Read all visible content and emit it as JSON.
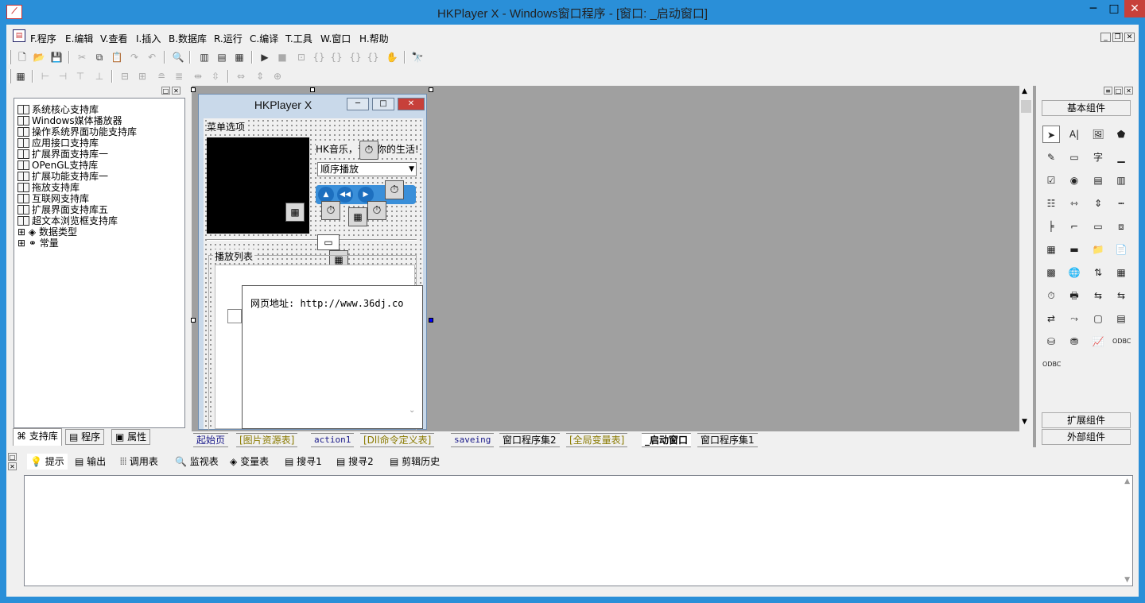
{
  "window": {
    "title": "HKPlayer X - Windows窗口程序 - [窗口: _启动窗口]",
    "min": "─",
    "max": "□",
    "close": "✕"
  },
  "menu": {
    "items": [
      "F.程序",
      "E.编辑",
      "V.查看",
      "I.插入",
      "B.数据库",
      "R.运行",
      "C.编译",
      "T.工具",
      "W.窗口",
      "H.帮助"
    ]
  },
  "left_panel": {
    "tree": [
      {
        "label": "系统核心支持库",
        "kind": "book"
      },
      {
        "label": "Windows媒体播放器",
        "kind": "book"
      },
      {
        "label": "操作系统界面功能支持库",
        "kind": "book"
      },
      {
        "label": "应用接口支持库",
        "kind": "book"
      },
      {
        "label": "扩展界面支持库一",
        "kind": "book"
      },
      {
        "label": "OPenGL支持库",
        "kind": "book"
      },
      {
        "label": "扩展功能支持库一",
        "kind": "book"
      },
      {
        "label": "拖放支持库",
        "kind": "book"
      },
      {
        "label": "互联网支持库",
        "kind": "book"
      },
      {
        "label": "扩展界面支持库五",
        "kind": "book"
      },
      {
        "label": "超文本浏览框支持库",
        "kind": "book"
      },
      {
        "label": "数据类型",
        "kind": "expand"
      },
      {
        "label": "常量",
        "kind": "expand"
      }
    ],
    "tabs": [
      "支持库",
      "程序",
      "属性"
    ]
  },
  "form": {
    "title": "HKPlayer X",
    "menu_label": "菜单选项",
    "slogan": "HK音乐，音乐你的生活!",
    "play_mode": "顺序播放",
    "playlist_label": "播放列表",
    "url_text": "网页地址: http://www.36dj.co"
  },
  "right_panel": {
    "basic": "基本组件",
    "extended": "扩展组件",
    "external": "外部组件"
  },
  "bottom_tabs": [
    "起始页",
    "[图片资源表]",
    "action1",
    "[Dll命令定义表]",
    "saveing",
    "窗口程序集2",
    "[全局变量表]",
    "_启动窗口",
    "窗口程序集1"
  ],
  "output_tabs": [
    "提示",
    "输出",
    "调用表",
    "监视表",
    "变量表",
    "搜寻1",
    "搜寻2",
    "剪辑历史"
  ],
  "colors": {
    "accent": "#2a8fd8",
    "designer_bg": "#a0a0a0",
    "form_frame": "#c9d9ea",
    "close_red": "#c7403a"
  }
}
